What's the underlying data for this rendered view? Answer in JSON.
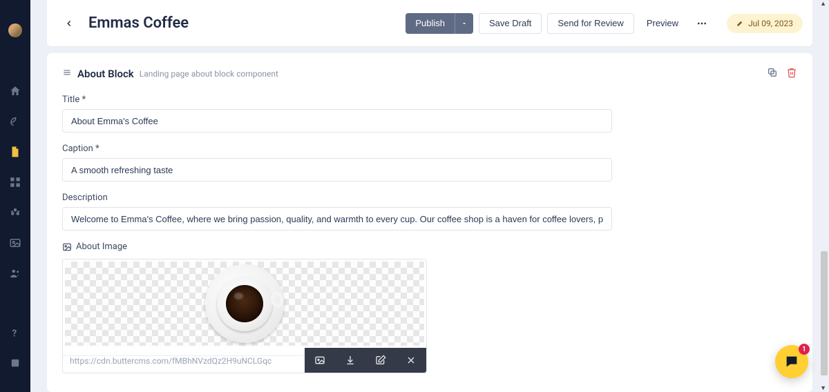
{
  "header": {
    "page_title": "Emmas Coffee",
    "publish_label": "Publish",
    "save_draft_label": "Save Draft",
    "send_review_label": "Send for Review",
    "preview_label": "Preview",
    "date_label": "Jul 09, 2023"
  },
  "block": {
    "title": "About Block",
    "description": "Landing page about block component",
    "fields": {
      "title_label": "Title",
      "title_value": "About Emma's Coffee",
      "caption_label": "Caption",
      "caption_value": "A smooth refreshing taste",
      "description_label": "Description",
      "description_value": "Welcome to Emma's Coffee, where we bring passion, quality, and warmth to every cup. Our coffee shop is a haven for coffee lovers, providing an inviting",
      "image_label": "About Image",
      "image_url": "https://cdn.buttercms.com/fMBhNVzdQz2H9uNCLGqc"
    }
  },
  "chat": {
    "badge_count": "1"
  },
  "required_mark": "*"
}
